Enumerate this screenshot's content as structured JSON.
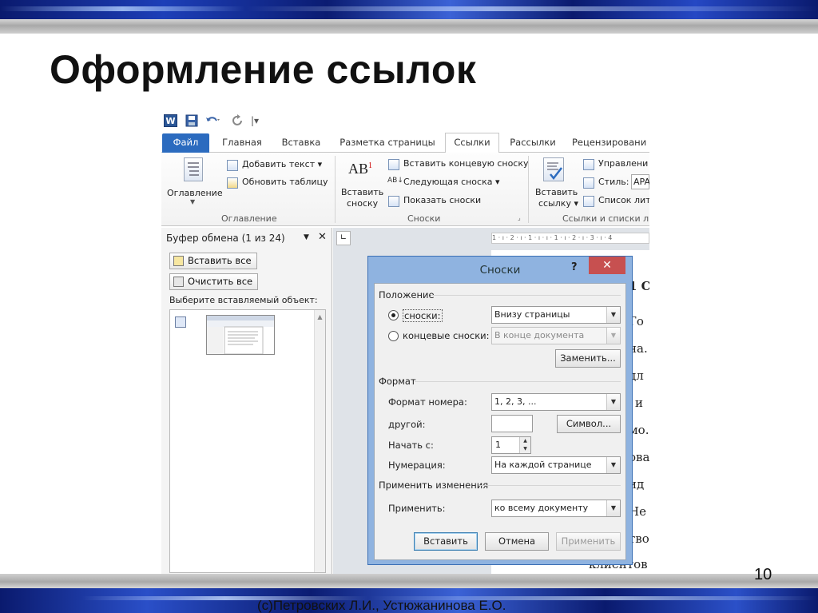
{
  "slide": {
    "title": "Оформление ссылок",
    "page_number": "10",
    "footer": "(c)Петровских Л.И., Устюжанинова Е.О."
  },
  "word": {
    "qat": {
      "app_icon": "W",
      "save_icon": "save-icon",
      "undo_icon": "undo-icon",
      "redo_icon": "redo-icon"
    },
    "tabs": [
      "Файл",
      "Главная",
      "Вставка",
      "Разметка страницы",
      "Ссылки",
      "Рассылки",
      "Рецензировани"
    ],
    "active_tab": "Ссылки",
    "ribbon": {
      "toc_button": "Оглавление",
      "add_text": "Добавить текст",
      "update_table": "Обновить таблицу",
      "group_toc": "Оглавление",
      "insert_footnote_1": "Вставить",
      "insert_footnote_2": "сноску",
      "footnote_icon_text": "AB",
      "insert_endnote": "Вставить концевую сноску",
      "next_footnote": "Следующая сноска",
      "show_notes": "Показать сноски",
      "group_footnotes": "Сноски",
      "insert_citation_1": "Вставить",
      "insert_citation_2": "ссылку",
      "manage_sources": "Управлени",
      "style_label": "Стиль:",
      "style_value": "APA",
      "bibliography": "Список лит",
      "group_citations": "Ссылки и списки ли"
    },
    "clipboard": {
      "title": "Буфер обмена (1 из 24)",
      "paste_all": "Вставить все",
      "clear_all": "Очистить все",
      "choose_item": "Выберите вставляемый объект:"
    },
    "ruler_text": "1 · ı · 2 · ı · 1 · ı · ı · 1 · ı · 2 · ı · 3 · ı · 4",
    "doc_lines": [
      "1 С",
      "Го",
      "на.",
      "дл",
      "и",
      "мо.",
      "ова",
      "ид",
      "Не",
      "тво",
      "клиентов"
    ]
  },
  "dialog": {
    "title": "Сноски",
    "help": "?",
    "close": "✕",
    "section_position": "Положение",
    "radio_footnotes": "сноски:",
    "radio_endnotes": "концевые сноски:",
    "footnotes_location": "Внизу страницы",
    "endnotes_location": "В конце документа",
    "convert_button": "Заменить...",
    "section_format": "Формат",
    "number_format_label": "Формат номера:",
    "number_format_value": "1, 2, 3, ...",
    "custom_mark_label": "другой:",
    "custom_mark_value": "",
    "symbol_button": "Символ...",
    "start_at_label": "Начать с:",
    "start_at_value": "1",
    "numbering_label": "Нумерация:",
    "numbering_value": "На каждой странице",
    "section_apply": "Применить изменения",
    "apply_to_label": "Применить:",
    "apply_to_value": "ко всему документу",
    "insert_button": "Вставить",
    "cancel_button": "Отмена",
    "apply_button": "Применить"
  },
  "colors": {
    "accent_blue": "#2b6bbf",
    "dialog_frame": "#8fb3e0",
    "close_red": "#c75050"
  }
}
